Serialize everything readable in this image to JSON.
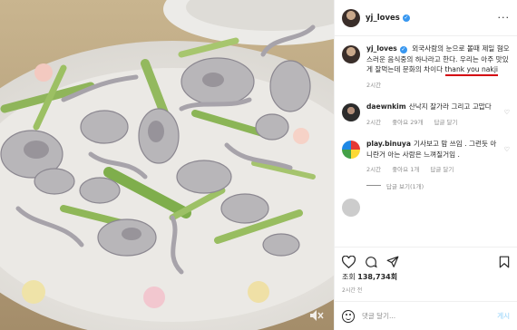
{
  "header": {
    "username": "yj_loves"
  },
  "caption": {
    "username": "yj_loves",
    "text_before": " 외국사람의 눈으로 볼때 제일 혐오스러운 음식중의 하나라고 한다. 우리는 아주 맛있게 잘먹는데 문화의 차이다 ",
    "underlined": "thank you nakji",
    "time": "2시간"
  },
  "comments": [
    {
      "username": "daewnkim",
      "text": "산낙지 잘가라 그리고 고맙다",
      "time": "2시간",
      "likes": "좋아요 29개",
      "reply": "답글 달기"
    },
    {
      "username": "play.binuya",
      "text": "기사보고 맘 쓰임 . 그런듯 아니란거 아는 사람은 느껴질거임 .",
      "time": "2시간",
      "likes": "좋아요 1개",
      "reply": "답글 달기",
      "view_replies": "답글 보기(1개)"
    }
  ],
  "stats": {
    "views_label": "조회",
    "views_count": "138,734회",
    "time": "2시간 전"
  },
  "add_comment": {
    "placeholder": "댓글 달기...",
    "post_label": "게시"
  },
  "colors": {
    "accent": "#3897f0",
    "underline": "#d4000f",
    "post_disabled": "#b2dffc"
  },
  "icons": [
    "more-icon",
    "verified-icon",
    "heart-icon",
    "comment-icon",
    "share-icon",
    "bookmark-icon",
    "emoji-icon",
    "video-icon"
  ]
}
